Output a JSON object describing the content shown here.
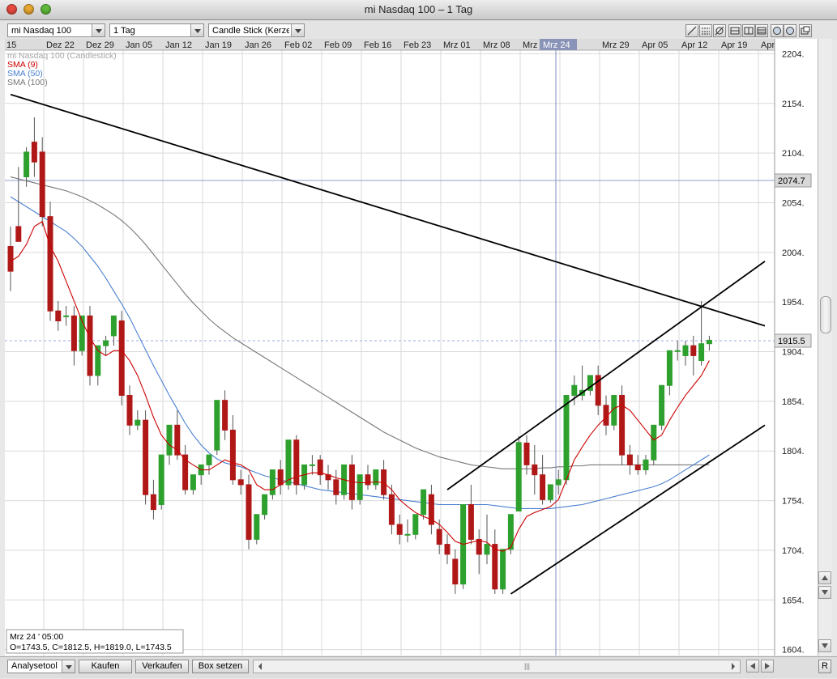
{
  "window": {
    "title": "mi Nasdaq 100 – 1 Tag"
  },
  "toolbar": {
    "instrument": "mi Nasdaq 100",
    "period": "1 Tag",
    "chart_type": "Candle Stick (Kerzer"
  },
  "chart": {
    "legend": [
      {
        "label": "mi Nasdaq 100 (Candlestick)",
        "color": "#a8a8a8"
      },
      {
        "label": "SMA (9)",
        "color": "#cc0000"
      },
      {
        "label": "SMA (50)",
        "color": "#4a7fd0"
      },
      {
        "label": "SMA (100)",
        "color": "#777777"
      }
    ],
    "price_marker_line": "2074.7",
    "price_marker_current": "1915.5",
    "info": {
      "date": "Mrz 24 ' 05:00",
      "ohlc": "O=1743.5, C=1812.5, H=1819.0, L=1743.5"
    },
    "colors": {
      "up": "#2ea02e",
      "down": "#b01818",
      "sma9": "#cc0000",
      "sma50": "#4a7fd0",
      "sma100": "#777777"
    }
  },
  "statusbar": {
    "tool": "Analysetool",
    "buy": "Kaufen",
    "sell": "Verkaufen",
    "set_box": "Box setzen",
    "right_btn": "R"
  },
  "chart_data": {
    "type": "candlestick",
    "date_labels": [
      "15",
      "Dez 22",
      "Dez 29",
      "Jan 05",
      "Jan 12",
      "Jan 19",
      "Jan 26",
      "Feb 02",
      "Feb 09",
      "Feb 16",
      "Feb 23",
      "Mrz 01",
      "Mrz 08",
      "Mrz 15",
      "Mrz 24",
      "Mrz 29",
      "Apr 05",
      "Apr 12",
      "Apr 19",
      "Apr 26"
    ],
    "highlighted_label": "Mrz 24",
    "y_ticks": [
      2204,
      2154,
      2104,
      2054,
      2004,
      1954,
      1904,
      1854,
      1804,
      1754,
      1704,
      1654,
      1604
    ],
    "ylim": [
      1598,
      2219
    ],
    "candles": [
      [
        2010,
        2030,
        1985,
        1965
      ],
      [
        2030,
        2090,
        2015,
        2015
      ],
      [
        2080,
        2110,
        2105,
        2070
      ],
      [
        2115,
        2140,
        2095,
        2080
      ],
      [
        2105,
        2120,
        2040,
        2030
      ],
      [
        2040,
        2055,
        1945,
        1935
      ],
      [
        1945,
        1955,
        1935,
        1925
      ],
      [
        1940,
        1950,
        1940,
        1930
      ],
      [
        1940,
        1950,
        1905,
        1890
      ],
      [
        1905,
        1915,
        1940,
        1900
      ],
      [
        1940,
        1950,
        1880,
        1870
      ],
      [
        1880,
        1890,
        1910,
        1870
      ],
      [
        1910,
        1920,
        1915,
        1900
      ],
      [
        1920,
        1940,
        1940,
        1910
      ],
      [
        1935,
        1945,
        1860,
        1850
      ],
      [
        1860,
        1870,
        1830,
        1820
      ],
      [
        1830,
        1845,
        1835,
        1825
      ],
      [
        1835,
        1845,
        1760,
        1750
      ],
      [
        1760,
        1775,
        1745,
        1735
      ],
      [
        1750,
        1760,
        1800,
        1745
      ],
      [
        1800,
        1820,
        1830,
        1790
      ],
      [
        1830,
        1845,
        1800,
        1795
      ],
      [
        1800,
        1810,
        1765,
        1760
      ],
      [
        1765,
        1780,
        1780,
        1760
      ],
      [
        1780,
        1790,
        1790,
        1770
      ],
      [
        1790,
        1800,
        1800,
        1780
      ],
      [
        1805,
        1815,
        1855,
        1800
      ],
      [
        1855,
        1865,
        1825,
        1815
      ],
      [
        1825,
        1840,
        1775,
        1770
      ],
      [
        1775,
        1785,
        1770,
        1760
      ],
      [
        1770,
        1780,
        1715,
        1705
      ],
      [
        1715,
        1725,
        1740,
        1710
      ],
      [
        1740,
        1750,
        1760,
        1735
      ],
      [
        1760,
        1770,
        1785,
        1755
      ],
      [
        1785,
        1795,
        1770,
        1760
      ],
      [
        1770,
        1780,
        1815,
        1765
      ],
      [
        1815,
        1820,
        1770,
        1760
      ],
      [
        1770,
        1780,
        1790,
        1765
      ],
      [
        1790,
        1800,
        1790,
        1780
      ],
      [
        1795,
        1800,
        1780,
        1770
      ],
      [
        1780,
        1790,
        1775,
        1765
      ],
      [
        1775,
        1785,
        1760,
        1750
      ],
      [
        1760,
        1770,
        1790,
        1755
      ],
      [
        1790,
        1800,
        1755,
        1745
      ],
      [
        1755,
        1770,
        1780,
        1750
      ],
      [
        1780,
        1790,
        1770,
        1765
      ],
      [
        1770,
        1785,
        1785,
        1765
      ],
      [
        1785,
        1795,
        1760,
        1755
      ],
      [
        1760,
        1770,
        1730,
        1720
      ],
      [
        1730,
        1740,
        1720,
        1710
      ],
      [
        1720,
        1735,
        1720,
        1712
      ],
      [
        1720,
        1730,
        1740,
        1715
      ],
      [
        1740,
        1760,
        1765,
        1735
      ],
      [
        1760,
        1770,
        1730,
        1720
      ],
      [
        1725,
        1735,
        1710,
        1700
      ],
      [
        1710,
        1720,
        1700,
        1690
      ],
      [
        1695,
        1705,
        1670,
        1660
      ],
      [
        1670,
        1700,
        1750,
        1665
      ],
      [
        1750,
        1770,
        1715,
        1710
      ],
      [
        1715,
        1725,
        1700,
        1680
      ],
      [
        1700,
        1740,
        1710,
        1690
      ],
      [
        1710,
        1725,
        1665,
        1660
      ],
      [
        1665,
        1690,
        1705,
        1660
      ],
      [
        1705,
        1740,
        1740,
        1700
      ],
      [
        1743.5,
        1819,
        1812.5,
        1743.5
      ],
      [
        1812,
        1820,
        1790,
        1780
      ],
      [
        1790,
        1810,
        1780,
        1760
      ],
      [
        1780,
        1800,
        1755,
        1750
      ],
      [
        1755,
        1770,
        1770,
        1752
      ],
      [
        1770,
        1785,
        1775,
        1760
      ],
      [
        1775,
        1830,
        1860,
        1770
      ],
      [
        1860,
        1880,
        1870,
        1850
      ],
      [
        1860,
        1890,
        1865,
        1855
      ],
      [
        1865,
        1875,
        1880,
        1860
      ],
      [
        1880,
        1890,
        1850,
        1840
      ],
      [
        1850,
        1860,
        1830,
        1820
      ],
      [
        1830,
        1850,
        1860,
        1825
      ],
      [
        1860,
        1870,
        1800,
        1790
      ],
      [
        1800,
        1810,
        1790,
        1780
      ],
      [
        1790,
        1800,
        1785,
        1780
      ],
      [
        1785,
        1800,
        1795,
        1780
      ],
      [
        1795,
        1810,
        1830,
        1790
      ],
      [
        1830,
        1860,
        1870,
        1825
      ],
      [
        1870,
        1890,
        1905,
        1860
      ],
      [
        1905,
        1915,
        1905,
        1895
      ],
      [
        1900,
        1915,
        1910,
        1890
      ],
      [
        1910,
        1920,
        1900,
        1880
      ],
      [
        1895,
        1955,
        1912,
        1890
      ],
      [
        1912,
        1920,
        1915.5,
        1905
      ]
    ],
    "sma9": [
      1995,
      2000,
      2012,
      2030,
      2035,
      2010,
      1995,
      1975,
      1955,
      1935,
      1918,
      1905,
      1900,
      1905,
      1905,
      1895,
      1880,
      1860,
      1838,
      1820,
      1810,
      1805,
      1795,
      1790,
      1785,
      1785,
      1790,
      1795,
      1792,
      1790,
      1785,
      1770,
      1765,
      1765,
      1770,
      1775,
      1778,
      1780,
      1782,
      1782,
      1780,
      1777,
      1775,
      1773,
      1772,
      1772,
      1773,
      1772,
      1765,
      1755,
      1748,
      1742,
      1738,
      1735,
      1730,
      1722,
      1713,
      1710,
      1712,
      1714,
      1712,
      1705,
      1703,
      1707,
      1725,
      1738,
      1742,
      1745,
      1748,
      1755,
      1775,
      1795,
      1808,
      1820,
      1830,
      1838,
      1847,
      1850,
      1845,
      1835,
      1825,
      1815,
      1820,
      1835,
      1848,
      1860,
      1870,
      1880,
      1895
    ],
    "sma50": [
      2060,
      2055,
      2050,
      2045,
      2040,
      2035,
      2030,
      2025,
      2018,
      2010,
      2000,
      1990,
      1978,
      1965,
      1952,
      1938,
      1922,
      1906,
      1890,
      1875,
      1860,
      1846,
      1832,
      1820,
      1810,
      1802,
      1796,
      1792,
      1790,
      1788,
      1785,
      1782,
      1779,
      1777,
      1775,
      1773,
      1771,
      1769,
      1767,
      1765,
      1764,
      1763,
      1762,
      1761,
      1760,
      1759,
      1758,
      1757,
      1756,
      1755,
      1754,
      1753,
      1752,
      1751,
      1750,
      1750,
      1750,
      1750,
      1750,
      1750,
      1750,
      1749,
      1748,
      1747,
      1746,
      1746,
      1746,
      1746,
      1746,
      1747,
      1748,
      1749,
      1750,
      1752,
      1754,
      1756,
      1758,
      1760,
      1762,
      1764,
      1766,
      1768,
      1771,
      1775,
      1780,
      1785,
      1790,
      1795,
      1800
    ],
    "sma100": [
      2080,
      2078,
      2076,
      2074,
      2072,
      2070,
      2068,
      2066,
      2063,
      2060,
      2056,
      2052,
      2047,
      2042,
      2036,
      2029,
      2021,
      2012,
      2002,
      1992,
      1982,
      1972,
      1962,
      1953,
      1945,
      1937,
      1930,
      1924,
      1918,
      1913,
      1908,
      1903,
      1898,
      1893,
      1888,
      1883,
      1878,
      1873,
      1868,
      1863,
      1858,
      1853,
      1848,
      1843,
      1838,
      1833,
      1828,
      1823,
      1819,
      1815,
      1811,
      1807,
      1804,
      1801,
      1798,
      1796,
      1794,
      1792,
      1790,
      1789,
      1788,
      1787,
      1786,
      1786,
      1786,
      1786,
      1786,
      1787,
      1787,
      1788,
      1788,
      1789,
      1789,
      1790,
      1790,
      1790,
      1790,
      1790,
      1790,
      1790,
      1790,
      1790,
      1790,
      1790,
      1790,
      1790,
      1790,
      1790,
      1790
    ],
    "trendlines": [
      {
        "from": [
          0,
          2163
        ],
        "to": [
          95,
          1930
        ]
      },
      {
        "from": [
          55,
          1765
        ],
        "to": [
          95,
          1995
        ]
      },
      {
        "from": [
          63,
          1660
        ],
        "to": [
          95,
          1830
        ]
      }
    ]
  }
}
